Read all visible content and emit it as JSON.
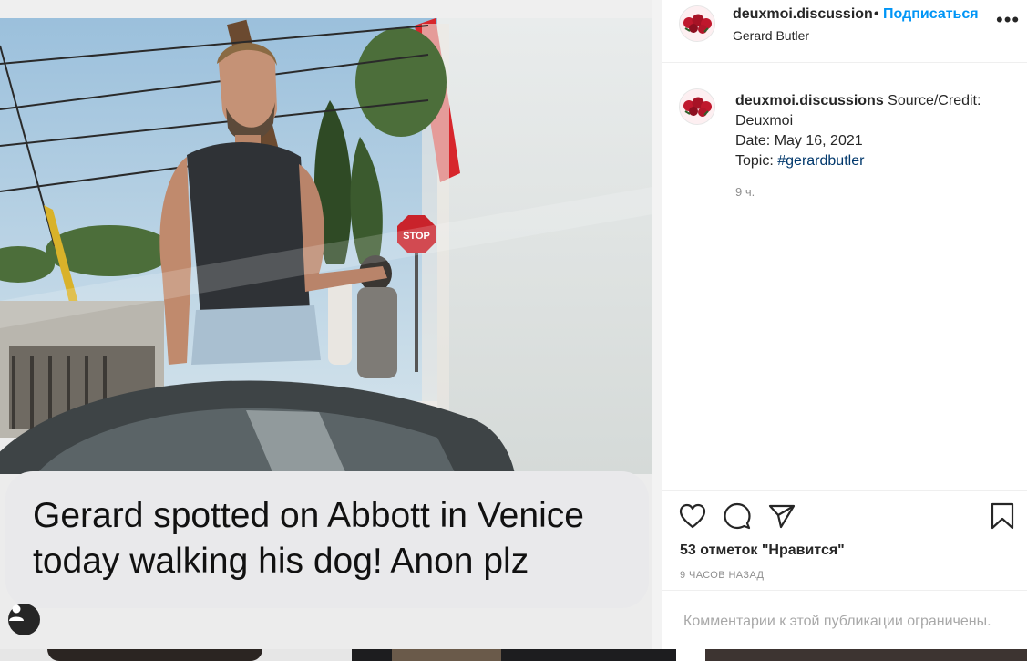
{
  "photo": {
    "message": "Gerard spotted on Abbott in Venice\ntoday walking his dog! Anon plz",
    "stop_sign": "STOP",
    "user_tag_icon": "person-icon"
  },
  "header": {
    "username": "deuxmoi.discussion",
    "dot": "•",
    "follow": "Подписаться",
    "subtitle": "Gerard Butler",
    "more_icon": "ellipsis-icon",
    "more_label": "•••"
  },
  "caption": {
    "username": "deuxmoi.discussions",
    "line1": " Source/Credit: Deuxmoi",
    "line2": "Date: May 16, 2021",
    "line3_prefix": "Topic: ",
    "hashtag": "#gerardbutler",
    "time": "9 ч."
  },
  "actions": {
    "like_icon": "heart-icon",
    "comment_icon": "comment-icon",
    "share_icon": "send-icon",
    "save_icon": "bookmark-icon",
    "likes": "53 отметок \"Нравится\"",
    "ago": "9 ЧАСОВ НАЗАД"
  },
  "comments": {
    "restricted": "Комментарии к этой публикации ограничены."
  },
  "colors": {
    "follow": "#0095f6",
    "hashtag": "#00376b",
    "muted": "#8e8e8e"
  }
}
